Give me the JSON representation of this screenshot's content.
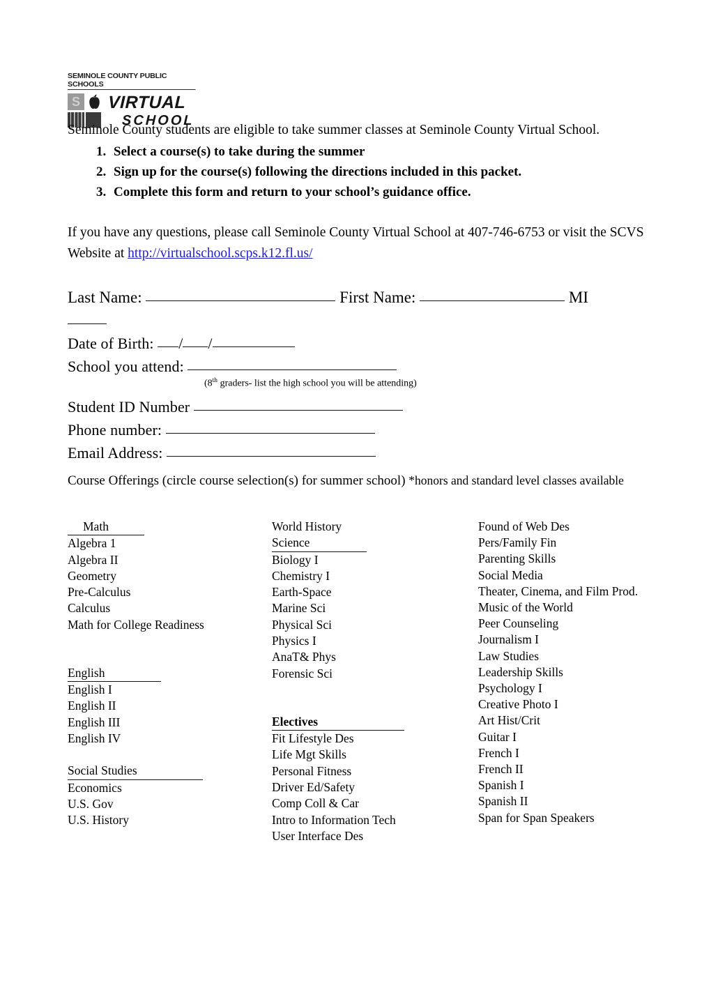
{
  "logo": {
    "top_text": "SEMINOLE COUNTY PUBLIC SCHOOLS",
    "word1": "VIRTUAL",
    "word2": "SCHOOL",
    "mark_letter": "S"
  },
  "intro": {
    "line": "Seminole County students are eligible to take summer classes at Seminole County Virtual School.",
    "steps": [
      "Select a course(s) to take during the summer",
      "Sign up for the course(s) following the directions included in this packet.",
      "Complete this form and return to your school’s guidance office."
    ]
  },
  "contact": {
    "text_before": "If you have any questions, please call Seminole County Virtual School at 407-746-6753 or visit the SCVS Website at ",
    "link": "http://virtualschool.scps.k12.fl.us/",
    "phone": "407-746-6753",
    "link_color": "#2020c8"
  },
  "form": {
    "last_name_label": "Last Name:",
    "first_name_label": "First Name:",
    "mi_label": "MI",
    "dob_label": "Date of Birth:",
    "dob_sep": "/",
    "school_label": "School you attend:",
    "school_note_pre": "(8",
    "school_note_sup": "th",
    "school_note_post": " graders- list the high school you will be attending)",
    "student_id_label": "Student ID Number",
    "phone_label": "Phone number:",
    "email_label": "Email Address:"
  },
  "offerings": {
    "heading_main": "Course Offerings (circle course selection(s) for summer school) ",
    "heading_small": "*honors and standard level classes available"
  },
  "columns": {
    "col1": [
      {
        "type": "header",
        "label": "Math"
      },
      {
        "type": "item",
        "label": "Algebra 1"
      },
      {
        "type": "item",
        "label": "Algebra II"
      },
      {
        "type": "item",
        "label": "Geometry"
      },
      {
        "type": "item",
        "label": "Pre-Calculus"
      },
      {
        "type": "item",
        "label": "Calculus"
      },
      {
        "type": "item",
        "label": "Math for College Readiness"
      },
      {
        "type": "gap-m",
        "label": ""
      },
      {
        "type": "header",
        "label": "English"
      },
      {
        "type": "item",
        "label": "English I"
      },
      {
        "type": "item",
        "label": "English II"
      },
      {
        "type": "item",
        "label": "English III"
      },
      {
        "type": "item",
        "label": "English IV"
      },
      {
        "type": "gap-s",
        "label": ""
      },
      {
        "type": "header",
        "label": "Social Studies"
      },
      {
        "type": "item",
        "label": "Economics"
      },
      {
        "type": "item",
        "label": "U.S. Gov"
      },
      {
        "type": "item",
        "label": "U.S. History"
      }
    ],
    "col2": [
      {
        "type": "item",
        "label": "World History"
      },
      {
        "type": "header",
        "label": "Science"
      },
      {
        "type": "item",
        "label": "Biology I"
      },
      {
        "type": "item",
        "label": "Chemistry I"
      },
      {
        "type": "item",
        "label": "Earth-Space"
      },
      {
        "type": "item",
        "label": "Marine Sci"
      },
      {
        "type": "item",
        "label": "Physical Sci"
      },
      {
        "type": "item",
        "label": "Physics I"
      },
      {
        "type": "item",
        "label": "AnaT& Phys"
      },
      {
        "type": "item",
        "label": "Forensic Sci"
      },
      {
        "type": "gap-m",
        "label": ""
      },
      {
        "type": "header-bold",
        "label": "Electives"
      },
      {
        "type": "item",
        "label": "Fit Lifestyle Des"
      },
      {
        "type": "item",
        "label": "Life Mgt Skills"
      },
      {
        "type": "item",
        "label": "Personal Fitness"
      },
      {
        "type": "item",
        "label": "Driver Ed/Safety"
      },
      {
        "type": "item",
        "label": "Comp Coll & Car"
      },
      {
        "type": "item",
        "label": "Intro to Information Tech"
      },
      {
        "type": "item",
        "label": "User Interface Des"
      }
    ],
    "col3": [
      {
        "type": "item",
        "label": "Found of Web Des"
      },
      {
        "type": "item",
        "label": "Pers/Family Fin"
      },
      {
        "type": "item",
        "label": "Parenting Skills"
      },
      {
        "type": "item",
        "label": "Social Media"
      },
      {
        "type": "item",
        "label": "Theater, Cinema, and Film Prod."
      },
      {
        "type": "item",
        "label": "Music of the World"
      },
      {
        "type": "item",
        "label": "Peer Counseling"
      },
      {
        "type": "item",
        "label": "Journalism I"
      },
      {
        "type": "item",
        "label": "Law Studies"
      },
      {
        "type": "item",
        "label": "Leadership Skills"
      },
      {
        "type": "item",
        "label": "Psychology I"
      },
      {
        "type": "item",
        "label": "Creative Photo I"
      },
      {
        "type": "item",
        "label": "Art Hist/Crit"
      },
      {
        "type": "item",
        "label": "Guitar I"
      },
      {
        "type": "item",
        "label": "French I"
      },
      {
        "type": "item",
        "label": "French II"
      },
      {
        "type": "item",
        "label": "Spanish I"
      },
      {
        "type": "item",
        "label": "Spanish II"
      },
      {
        "type": "item",
        "label": "Span for Span Speakers"
      }
    ]
  }
}
